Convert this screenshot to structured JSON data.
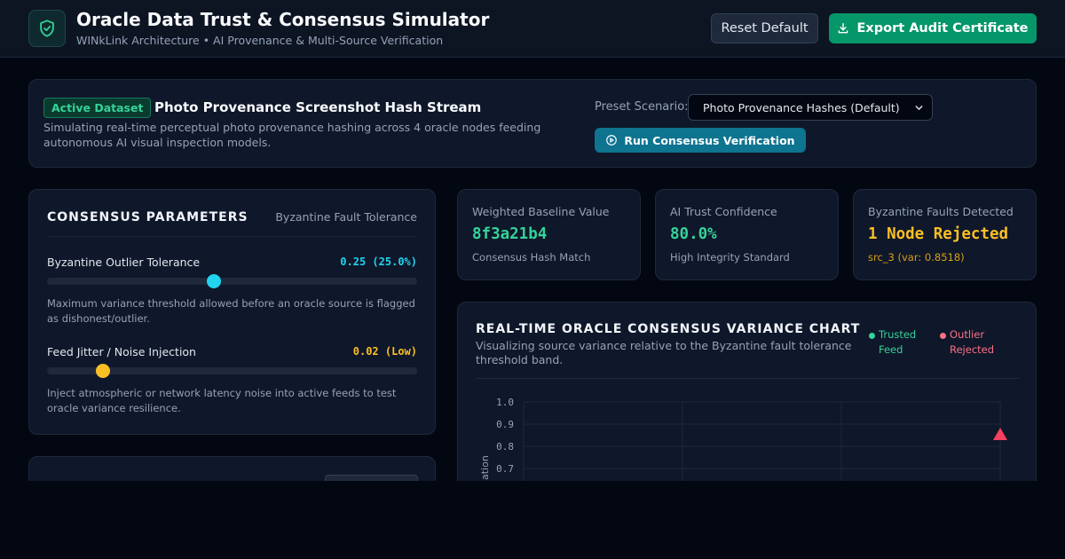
{
  "header": {
    "title": "Oracle Data Trust & Consensus Simulator",
    "subtitle": "WINkLink Architecture • AI Provenance & Multi-Source Verification",
    "reset_label": "Reset Default",
    "export_label": "Export Audit Certificate",
    "logo_icon": "shield-check-icon",
    "export_icon": "download-icon"
  },
  "dataset": {
    "badge": "Active Dataset",
    "title": "Photo Provenance Screenshot Hash Stream",
    "description": "Simulating real-time perceptual photo provenance hashing across 4 oracle nodes feeding autonomous AI visual inspection models.",
    "preset_label": "Preset Scenario:",
    "preset_value": "Photo Provenance Hashes (Default)",
    "run_label": "Run Consensus Verification",
    "run_icon": "play-circle-icon"
  },
  "params": {
    "title": "CONSENSUS PARAMETERS",
    "subtitle": "Byzantine Fault Tolerance",
    "outlier": {
      "label": "Byzantine Outlier Tolerance",
      "value_text": "0.25 (25.0%)",
      "fraction": 0.45,
      "description": "Maximum variance threshold allowed before an oracle source is flagged as dishonest/outlier."
    },
    "jitter": {
      "label": "Feed Jitter / Noise Injection",
      "value_text": "0.02 (Low)",
      "fraction": 0.15,
      "description": "Inject atmospheric or network latency noise into active feeds to test oracle variance resilience."
    }
  },
  "stats": [
    {
      "label": "Weighted Baseline Value",
      "value": "8f3a21b4",
      "note": "Consensus Hash Match"
    },
    {
      "label": "AI Trust Confidence",
      "value": "80.0%",
      "note": "High Integrity Standard"
    },
    {
      "label": "Byzantine Faults Detected",
      "value": "1 Node Rejected",
      "note": "src_3 (var: 0.8518)"
    }
  ],
  "chart": {
    "title": "REAL-TIME ORACLE CONSENSUS VARIANCE CHART",
    "subtitle": "Visualizing source variance relative to the Byzantine fault tolerance threshold band.",
    "legend": [
      {
        "label": "Trusted Feed",
        "color": "#34d399"
      },
      {
        "label": "Outlier Rejected",
        "color": "#fb7185"
      }
    ],
    "ylabel_fragment": "ation"
  },
  "colors": {
    "accent_cyan": "#22d3ee",
    "accent_amber": "#fbbf24",
    "trusted": "#34d399",
    "outlier": "#f43f5e"
  },
  "chart_data": {
    "type": "scatter",
    "title": "REAL-TIME ORACLE CONSENSUS VARIANCE CHART",
    "xlabel": "",
    "ylabel": "",
    "y_ticks": [
      "1.0",
      "0.9",
      "0.8",
      "0.7"
    ],
    "ylim_visible": [
      0.7,
      1.0
    ],
    "x_slots": 4,
    "grid": true,
    "series": [
      {
        "name": "Outlier Rejected",
        "marker": "triangle",
        "points": [
          {
            "x": 4,
            "y": 0.8518
          }
        ]
      }
    ]
  }
}
